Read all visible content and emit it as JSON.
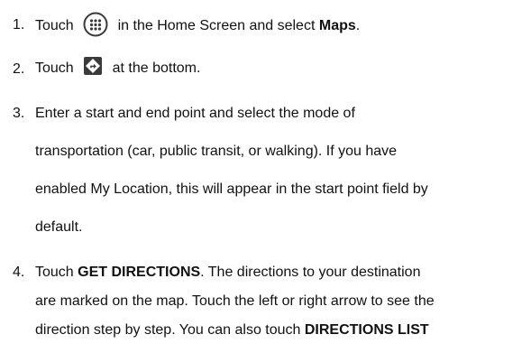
{
  "steps": [
    {
      "number": "1.",
      "lines": [
        {
          "before_icon": "Touch",
          "icon": "apps-grid-icon",
          "after_icon": "in the Home Screen and select",
          "bold": "Maps",
          "after_bold": "."
        }
      ]
    },
    {
      "number": "2.",
      "lines": [
        {
          "before_icon": "Touch",
          "icon": "directions-icon",
          "after_icon": "at the bottom."
        }
      ]
    },
    {
      "number": "3.",
      "lines": [
        "Enter a start and end point and select the mode of",
        "transportation (car, public transit, or walking). If you have",
        "enabled My Location, this will appear in the start point field by",
        "default."
      ]
    },
    {
      "number": "4.",
      "lines": [
        {
          "before_bold": "Touch",
          "bold": "GET DIRECTIONS",
          "after_bold": ". The directions to your destination"
        },
        "are marked on the map. Touch the left or right arrow to see the",
        {
          "before_bold": "direction step by step. You can also touch",
          "bold": "DIRECTIONS LIST"
        }
      ]
    }
  ],
  "colors": {
    "text": "#111111",
    "icon_fill": "#3a3a3a",
    "icon_accent": "#ffffff"
  }
}
